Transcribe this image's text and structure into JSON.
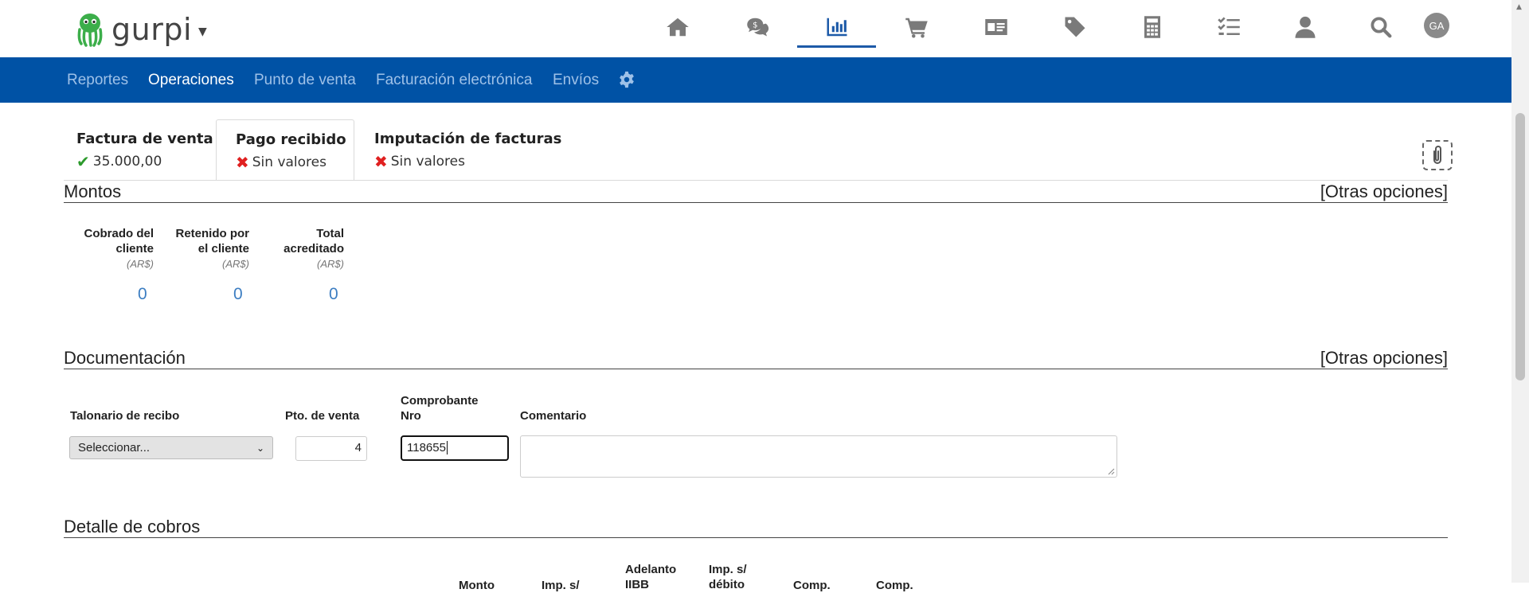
{
  "app": {
    "name": "gurpi"
  },
  "user": {
    "initials": "GA"
  },
  "nav_icons": [
    "home-icon",
    "chat-money-icon",
    "bar-chart-icon",
    "cart-icon",
    "id-card-icon",
    "tag-icon",
    "calculator-icon",
    "checklist-icon",
    "user-icon",
    "search-icon"
  ],
  "subnav": {
    "items": [
      "Reportes",
      "Operaciones",
      "Punto de venta",
      "Facturación electrónica",
      "Envíos"
    ],
    "active": "Operaciones"
  },
  "tabs": [
    {
      "title": "Factura de venta",
      "status": "35.000,00",
      "state": "ok"
    },
    {
      "title": "Pago recibido",
      "status": "Sin valores",
      "state": "bad"
    },
    {
      "title": "Imputación de facturas",
      "status": "Sin valores",
      "state": "bad"
    }
  ],
  "montos": {
    "title": "Montos",
    "options": "[Otras opciones]",
    "columns": [
      {
        "label": "Cobrado del cliente",
        "unit": "(AR$)",
        "value": "0"
      },
      {
        "label": "Retenido por el cliente",
        "unit": "(AR$)",
        "value": "0"
      },
      {
        "label": "Total acreditado",
        "unit": "(AR$)",
        "value": "0"
      }
    ]
  },
  "documentacion": {
    "title": "Documentación",
    "options": "[Otras opciones]",
    "talonario_label": "Talonario de recibo",
    "talonario_value": "Seleccionar...",
    "pto_label": "Pto. de venta",
    "pto_value": "4",
    "comprobante_label": "Comprobante Nro",
    "comprobante_value": "118655",
    "comentario_label": "Comentario",
    "comentario_value": ""
  },
  "detalle": {
    "title": "Detalle de cobros",
    "column_headers": [
      "Monto",
      "Imp. s/",
      "Adelanto IIBB",
      "Imp. s/ débito",
      "Comp.",
      "Comp."
    ]
  }
}
